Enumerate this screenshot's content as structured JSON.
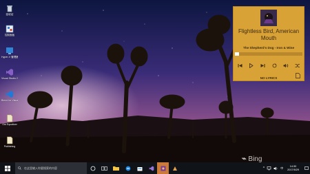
{
  "desktop": {
    "icons": [
      {
        "name": "recycle-bin",
        "label": "回收站"
      },
      {
        "name": "control-panel",
        "label": "控制面板"
      },
      {
        "name": "hyperv-manager",
        "label": "Hyper-V 管理器"
      },
      {
        "name": "visual-studio",
        "label": "Visual Studio 2017"
      },
      {
        "name": "blend",
        "label": "Blend for Visual..."
      },
      {
        "name": "old-equalizer",
        "label": "Old Equalizer"
      },
      {
        "name": "publishing",
        "label": "Publishing"
      }
    ],
    "bing_text": "Bing"
  },
  "player": {
    "title": "Flightless Bird, American Mouth",
    "artist": "The Shepherd's Dog - Iron & Wine",
    "progress": 0.06,
    "lyrics_label": "NO LYRICS",
    "colors": {
      "background": "#d9a236",
      "text": "#3b2a10"
    }
  },
  "taskbar": {
    "search_placeholder": "在这里输入你要搜索的内容",
    "time": "14:30",
    "date": "2017/6/29"
  }
}
